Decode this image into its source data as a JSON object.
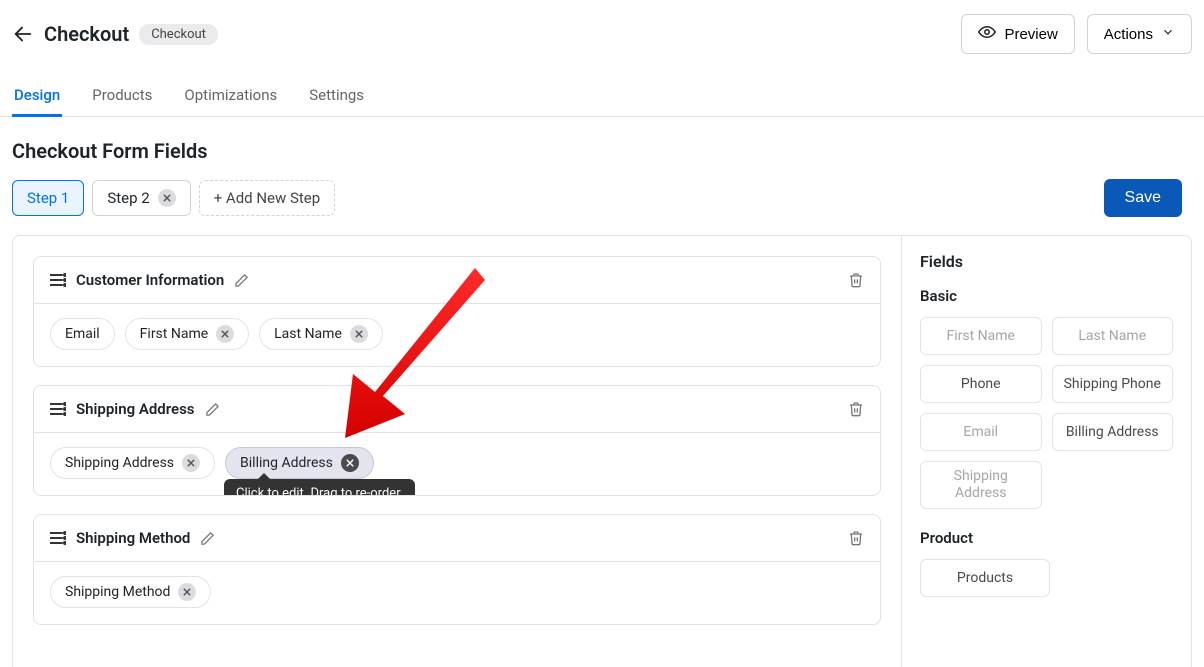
{
  "header": {
    "title": "Checkout",
    "badge": "Checkout",
    "preview": "Preview",
    "actions": "Actions"
  },
  "tabs": {
    "design": "Design",
    "products": "Products",
    "optimizations": "Optimizations",
    "settings": "Settings"
  },
  "section_title": "Checkout Form Fields",
  "steps": {
    "step1": "Step 1",
    "step2": "Step 2",
    "add": "+ Add New Step",
    "save": "Save"
  },
  "cards": {
    "customer": {
      "title": "Customer Information",
      "fields": {
        "email": "Email",
        "first_name": "First Name",
        "last_name": "Last Name"
      }
    },
    "shipping_addr": {
      "title": "Shipping Address",
      "fields": {
        "shipping": "Shipping Address",
        "billing": "Billing Address"
      }
    },
    "shipping_method": {
      "title": "Shipping Method",
      "fields": {
        "method": "Shipping Method"
      }
    }
  },
  "tooltip": "Click to edit. Drag to re-order.",
  "sidebar": {
    "title": "Fields",
    "basic": "Basic",
    "product": "Product",
    "fields": {
      "first_name": "First Name",
      "last_name": "Last Name",
      "phone": "Phone",
      "shipping_phone": "Shipping Phone",
      "email": "Email",
      "billing_address": "Billing Address",
      "shipping_address": "Shipping Address",
      "products": "Products"
    }
  }
}
